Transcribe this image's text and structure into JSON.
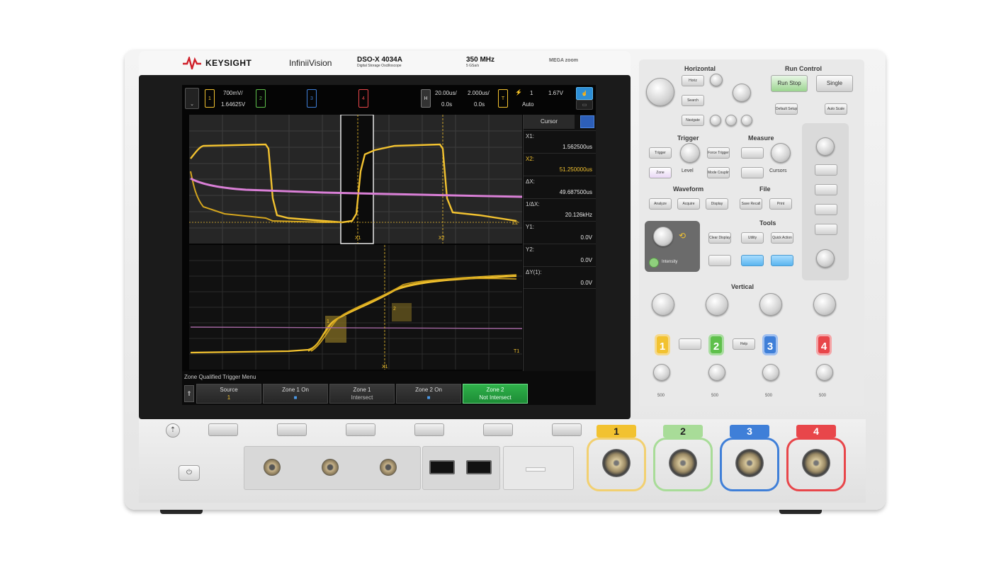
{
  "brand": {
    "name": "KEYSIGHT",
    "series": "InfiniiVision"
  },
  "model": {
    "name": "DSO-X 4034A",
    "subtitle": "Digital Storage Oscilloscope"
  },
  "bandwidth": {
    "value": "350 MHz",
    "sample_rate": "5 GSa/s"
  },
  "mega_zoom": "MEGA zoom",
  "status_bar": {
    "ch1_scale": "700mV/",
    "ch1_offset": "1.64625V",
    "ch1_label": "1",
    "ch2_label": "2",
    "ch3_label": "3",
    "ch4_label": "4",
    "h_label": "H",
    "time_scale_main": "20.00us/",
    "time_scale_zoom": "2.000us/",
    "delay_main": "0.0s",
    "delay_zoom": "0.0s",
    "trig_label": "T",
    "trig_channel": "1",
    "trig_level": "1.67V",
    "trig_mode": "Auto"
  },
  "cursor_panel": {
    "title": "Cursor",
    "rows": [
      {
        "label": "X1:",
        "value": "1.562500us"
      },
      {
        "label": "X2:",
        "value": "51.250000us"
      },
      {
        "label": "ΔX:",
        "value": "49.687500us"
      },
      {
        "label": "1/ΔX:",
        "value": "20.126kHz"
      },
      {
        "label": "Y1:",
        "value": "0.0V"
      },
      {
        "label": "Y2:",
        "value": "0.0V"
      },
      {
        "label": "ΔY(1):",
        "value": "0.0V"
      }
    ]
  },
  "waveform_markers": {
    "x1": "X1",
    "x2": "X2",
    "z2": "Z2",
    "t1": "T1",
    "z1_box": "1",
    "z2_box": "2"
  },
  "softkeys": {
    "menu_title": "Zone Qualified Trigger Menu",
    "keys": [
      {
        "label": "Source",
        "value": "1"
      },
      {
        "label": "Zone 1 On",
        "value": "■"
      },
      {
        "label": "Zone 1",
        "value": "Intersect"
      },
      {
        "label": "Zone 2 On",
        "value": "■"
      },
      {
        "label": "Zone 2",
        "value": "Not Intersect"
      }
    ]
  },
  "panel": {
    "horizontal": "Horizontal",
    "run_control": "Run Control",
    "run_stop": "Run Stop",
    "single": "Single",
    "default_setup": "Default Setup",
    "auto_scale": "Auto Scale",
    "horiz_menu": "Horiz",
    "search": "Search",
    "navigate": "Navigate",
    "trigger": "Trigger",
    "measure": "Measure",
    "trigger_btn": "Trigger",
    "force_trigger": "Force Trigger",
    "zone": "Zone",
    "mode_coupling": "Mode Coupling",
    "level": "Level",
    "cursors": "Cursors",
    "waveform": "Waveform",
    "file": "File",
    "analyze": "Analyze",
    "acquire": "Acquire",
    "display": "Display",
    "save_recall": "Save Recall",
    "print": "Print",
    "tools": "Tools",
    "clear_display": "Clear Display",
    "utility": "Utility",
    "quick_action": "Quick Action",
    "intensity": "Intensity",
    "vertical": "Vertical",
    "help": "Help",
    "channels": [
      "1",
      "2",
      "3",
      "4"
    ],
    "ports": [
      "1",
      "2",
      "3",
      "4"
    ],
    "dial_nums": [
      "500",
      "500",
      "500",
      "500"
    ]
  },
  "colors": {
    "ch1": "#f2c230",
    "ch2": "#5fc04b",
    "ch3": "#3f7fd8",
    "ch4": "#e8464a",
    "math": "#d97fd6",
    "accent_green": "#2fb24a"
  }
}
